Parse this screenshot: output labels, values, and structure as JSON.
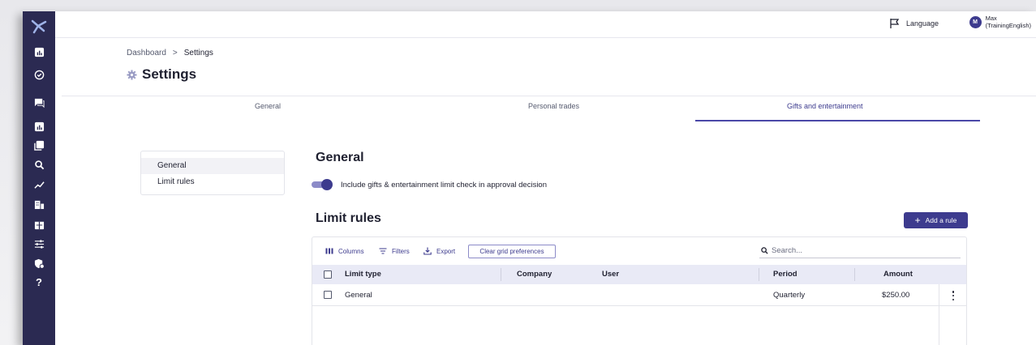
{
  "topbar": {
    "language_label": "Language",
    "user_initial": "M",
    "user_name_line1": "Max",
    "user_name_line2": "(TrainingEnglish)"
  },
  "breadcrumb": {
    "root": "Dashboard",
    "separator": ">",
    "current": "Settings"
  },
  "page": {
    "title": "Settings"
  },
  "tabs": [
    {
      "label": "General"
    },
    {
      "label": "Personal trades"
    },
    {
      "label": "Gifts and entertainment",
      "active": true
    }
  ],
  "sidenav": [
    {
      "label": "General",
      "selected": true
    },
    {
      "label": "Limit rules"
    }
  ],
  "general_section": {
    "title": "General",
    "toggle_label": "Include gifts & entertainment limit check in approval decision",
    "toggle_on": true
  },
  "limit_rules": {
    "title": "Limit rules",
    "add_button": "Add a rule",
    "toolbar": {
      "columns": "Columns",
      "filters": "Filters",
      "export": "Export",
      "clear": "Clear grid preferences",
      "search_placeholder": "Search..."
    },
    "columns": [
      "Limit type",
      "Company",
      "User",
      "Period",
      "Amount"
    ],
    "rows": [
      {
        "limit_type": "General",
        "company": "",
        "user": "",
        "period": "Quarterly",
        "amount": "$250.00"
      }
    ]
  },
  "colors": {
    "sidebar": "#2b2a52",
    "accent": "#3d3b8e",
    "header_row": "#e9eaf6"
  },
  "sidebar_icons": [
    "logo-icon",
    "dashboard-icon",
    "check-circle-icon",
    "chat-icon",
    "report-icon",
    "documents-icon",
    "search-icon",
    "trend-icon",
    "building-icon",
    "gift-icon",
    "sliders-icon",
    "shield-icon",
    "help-icon"
  ]
}
